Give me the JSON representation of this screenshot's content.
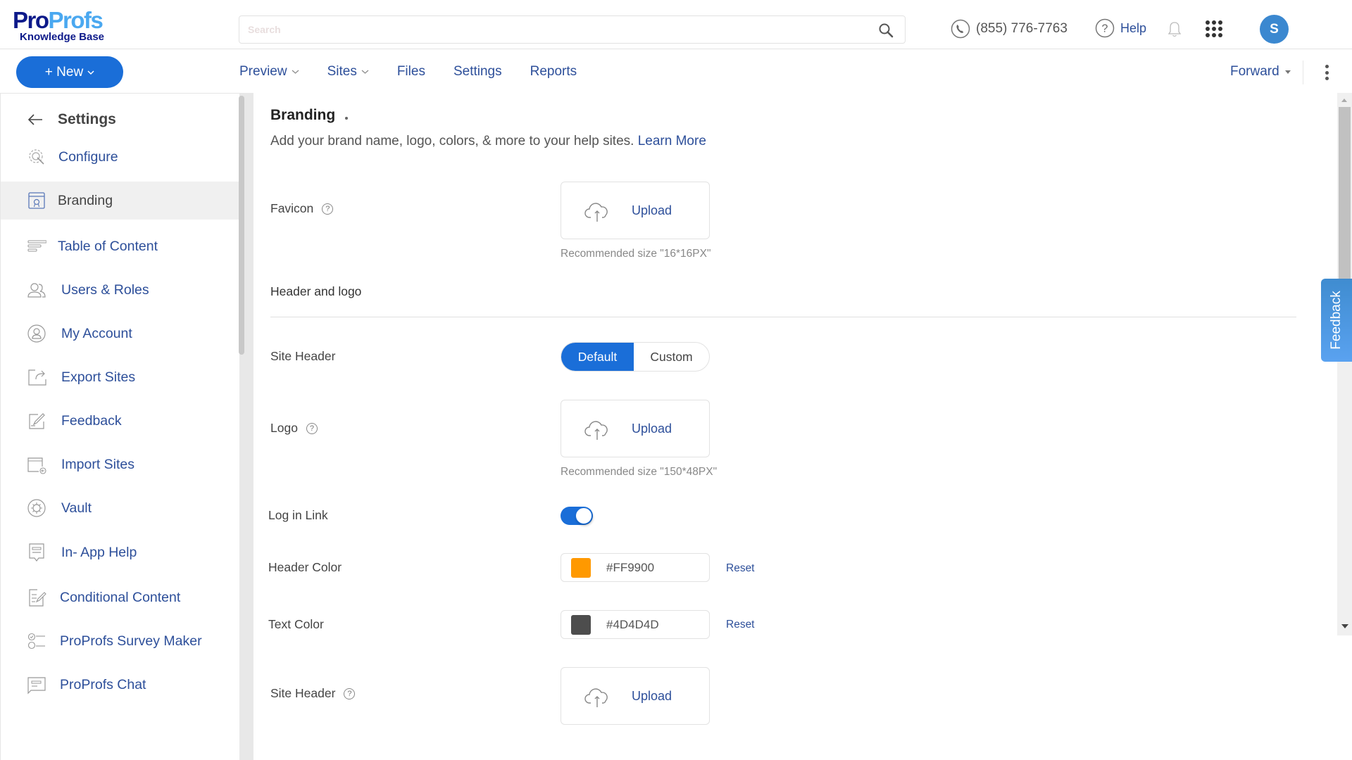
{
  "header": {
    "logo": {
      "brand_part1": "Pro",
      "brand_part2": "Profs",
      "subtitle": "Knowledge Base"
    },
    "search": {
      "placeholder": "Search",
      "value": ""
    },
    "phone": "(855) 776-7763",
    "help_label": "Help",
    "avatar_initial": "S"
  },
  "toolbar": {
    "new_label": "+ New",
    "nav": [
      {
        "label": "Preview",
        "has_dropdown": true
      },
      {
        "label": "Sites",
        "has_dropdown": true
      },
      {
        "label": "Files",
        "has_dropdown": false
      },
      {
        "label": "Settings",
        "has_dropdown": false
      },
      {
        "label": "Reports",
        "has_dropdown": false
      }
    ],
    "forward_label": "Forward"
  },
  "sidebar": {
    "title": "Settings",
    "items": [
      {
        "label": "Configure",
        "icon": "gear-wrench-icon",
        "active": false
      },
      {
        "label": "Branding",
        "icon": "branding-icon",
        "active": true
      },
      {
        "label": "Table of Content",
        "icon": "table-of-content-icon",
        "active": false
      },
      {
        "label": "Users & Roles",
        "icon": "users-icon",
        "active": false
      },
      {
        "label": "My Account",
        "icon": "user-circle-icon",
        "active": false
      },
      {
        "label": "Export Sites",
        "icon": "export-icon",
        "active": false
      },
      {
        "label": "Feedback",
        "icon": "edit-icon",
        "active": false
      },
      {
        "label": "Import Sites",
        "icon": "import-icon",
        "active": false
      },
      {
        "label": "Vault",
        "icon": "vault-icon",
        "active": false
      },
      {
        "label": "In- App Help",
        "icon": "in-app-help-icon",
        "active": false
      },
      {
        "label": "Conditional Content",
        "icon": "conditional-content-icon",
        "active": false
      },
      {
        "label": "ProProfs Survey Maker",
        "icon": "survey-icon",
        "active": false
      },
      {
        "label": "ProProfs Chat",
        "icon": "chat-icon",
        "active": false
      }
    ]
  },
  "main": {
    "title": "Branding",
    "subtitle": "Add your brand name, logo, colors, & more to your help sites.",
    "learn_more": "Learn More",
    "favicon": {
      "label": "Favicon",
      "upload_label": "Upload",
      "hint": "Recommended size \"16*16PX\""
    },
    "section_header_logo": "Header and logo",
    "site_header": {
      "label": "Site Header",
      "options": [
        "Default",
        "Custom"
      ],
      "selected": "Default"
    },
    "logo": {
      "label": "Logo",
      "upload_label": "Upload",
      "hint": "Recommended size \"150*48PX\""
    },
    "login_link": {
      "label": "Log in Link",
      "enabled": true
    },
    "header_color": {
      "label": "Header Color",
      "value": "#FF9900",
      "swatch": "#FF9900",
      "reset_label": "Reset"
    },
    "text_color": {
      "label": "Text Color",
      "value": "#4D4D4D",
      "swatch": "#4D4D4D",
      "reset_label": "Reset"
    },
    "site_header_image": {
      "label": "Site Header",
      "upload_label": "Upload"
    }
  },
  "feedback_tab": "Feedback",
  "colors": {
    "accent": "#1A6ED8",
    "link": "#2D4F9A",
    "avatar": "#3B88D0"
  }
}
